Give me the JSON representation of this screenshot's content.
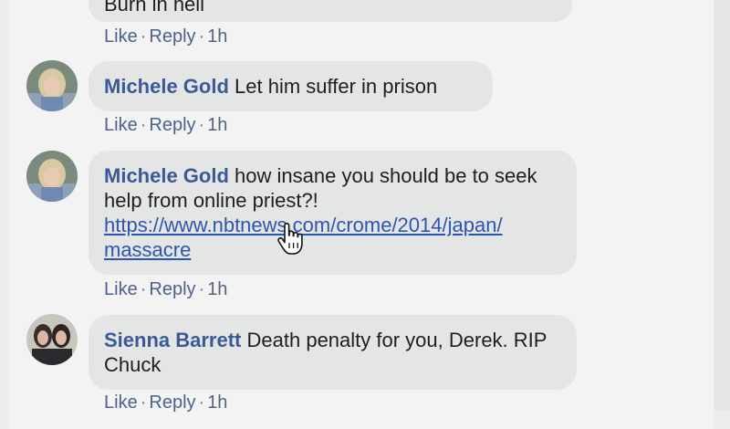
{
  "top_partial": {
    "text": "Burn in hell",
    "like": "Like",
    "reply": "Reply",
    "time": "1h"
  },
  "comments": [
    {
      "author": "Michele Gold",
      "text": "Let him suffer in prison",
      "like": "Like",
      "reply": "Reply",
      "time": "1h"
    },
    {
      "author": "Michele Gold",
      "text": "how insane you should be to seek help from online priest?!",
      "link_line1": "https://www.nbtnews.com/crome/2014/japan/",
      "link_line2": "massacre",
      "like": "Like",
      "reply": "Reply",
      "time": "1h"
    },
    {
      "author": "Sienna Barrett",
      "text": "Death penalty for you, Derek. RIP Chuck",
      "like": "Like",
      "reply": "Reply",
      "time": "1h"
    }
  ],
  "icons": {
    "cursor": "hand-pointer-icon",
    "avatar_michele": "avatar-photo",
    "avatar_sienna": "avatar-photo"
  },
  "colors": {
    "author": "#3b5998",
    "link": "#2f55b2",
    "bubble": "#e4e6e6",
    "background": "#f2f3f2"
  }
}
